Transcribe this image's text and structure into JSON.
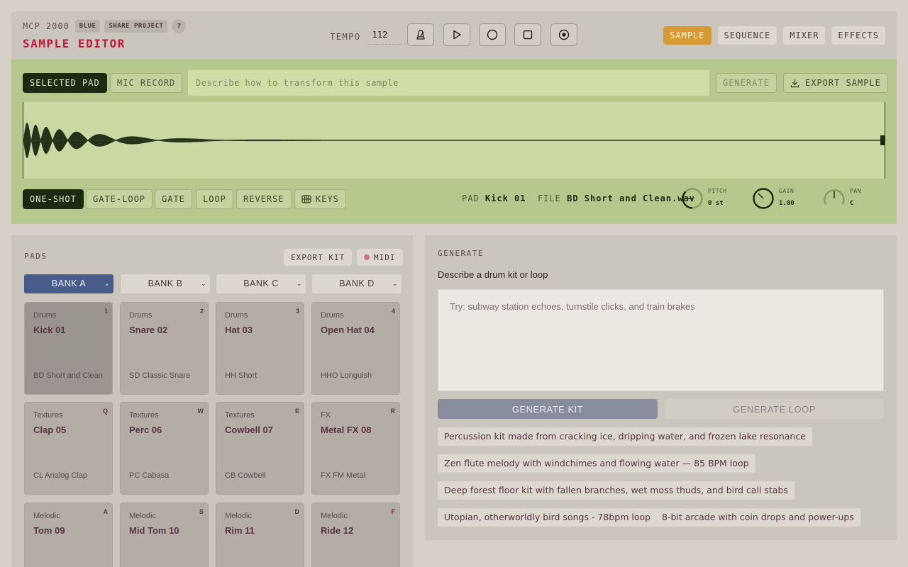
{
  "header": {
    "brand": "MCP 2000",
    "theme_chip": "BLUE",
    "share_label": "SHARE PROJECT",
    "help_label": "?",
    "title": "SAMPLE EDITOR",
    "tempo_label": "TEMPO",
    "tempo_value": "112",
    "transport": [
      "metronome-icon",
      "play-icon",
      "record-icon",
      "stop-icon",
      "loop-record-icon"
    ],
    "tabs": [
      {
        "label": "SAMPLE",
        "active": true
      },
      {
        "label": "SEQUENCE",
        "active": false
      },
      {
        "label": "MIXER",
        "active": false
      },
      {
        "label": "EFFECTS",
        "active": false
      }
    ],
    "accent_color": "#d89a35",
    "title_color": "#c2163a"
  },
  "editor": {
    "selected_pad_label": "SELECTED PAD",
    "mic_record_label": "MIC RECORD",
    "prompt_placeholder": "Describe how to transform this sample",
    "generate_label": "GENERATE",
    "export_label": "EXPORT SAMPLE",
    "modes": [
      "ONE-SHOT",
      "GATE-LOOP",
      "GATE",
      "LOOP",
      "REVERSE"
    ],
    "active_mode": "ONE-SHOT",
    "keys_label": "KEYS",
    "pad_label": "PAD",
    "pad_value": "Kick 01",
    "file_label": "FILE",
    "file_value": "BD Short and Clean.wav",
    "knobs": {
      "pitch": {
        "label": "PITCH",
        "value": "0 st"
      },
      "gain": {
        "label": "GAIN",
        "value": "1.00"
      },
      "pan": {
        "label": "PAN",
        "value": "C"
      }
    },
    "panel_color": "#b6c88e"
  },
  "pads": {
    "label": "PADS",
    "export_kit_label": "EXPORT KIT",
    "midi_label": "MIDI",
    "banks": [
      "BANK A",
      "BANK B",
      "BANK C",
      "BANK D"
    ],
    "active_bank": "BANK A",
    "items": [
      {
        "category": "Drums",
        "name": "Kick 01",
        "key": "1",
        "file": "BD Short and Clean",
        "selected": true
      },
      {
        "category": "Drums",
        "name": "Snare 02",
        "key": "2",
        "file": "SD Classic Snare"
      },
      {
        "category": "Drums",
        "name": "Hat 03",
        "key": "3",
        "file": "HH Short"
      },
      {
        "category": "Drums",
        "name": "Open Hat 04",
        "key": "4",
        "file": "HHO Longuish"
      },
      {
        "category": "Textures",
        "name": "Clap 05",
        "key": "Q",
        "file": "CL Analog Clap"
      },
      {
        "category": "Textures",
        "name": "Perc 06",
        "key": "W",
        "file": "PC Cabasa"
      },
      {
        "category": "Textures",
        "name": "Cowbell 07",
        "key": "E",
        "file": "CB Cowbell"
      },
      {
        "category": "FX",
        "name": "Metal FX 08",
        "key": "R",
        "file": "FX FM Metal"
      },
      {
        "category": "Melodic",
        "name": "Tom 09",
        "key": "A",
        "file": ""
      },
      {
        "category": "Melodic",
        "name": "Mid Tom 10",
        "key": "S",
        "file": ""
      },
      {
        "category": "Melodic",
        "name": "Rim 11",
        "key": "D",
        "file": ""
      },
      {
        "category": "Melodic",
        "name": "Ride 12",
        "key": "F",
        "file": ""
      }
    ]
  },
  "generate": {
    "label": "GENERATE",
    "subtitle": "Describe a drum kit or loop",
    "placeholder": "Try: subway station echoes, turnstile clicks, and train brakes",
    "kit_label": "GENERATE KIT",
    "loop_label": "GENERATE LOOP",
    "suggestions": [
      "Percussion kit made from cracking ice, dripping water, and frozen lake resonance",
      "Zen flute melody with windchimes and flowing water — 85 BPM loop",
      "Deep forest floor kit with fallen branches, wet moss thuds, and bird call stabs",
      "Utopian, otherworldly bird songs - 78bpm loop",
      "8-bit arcade with coin drops and power-ups"
    ]
  }
}
